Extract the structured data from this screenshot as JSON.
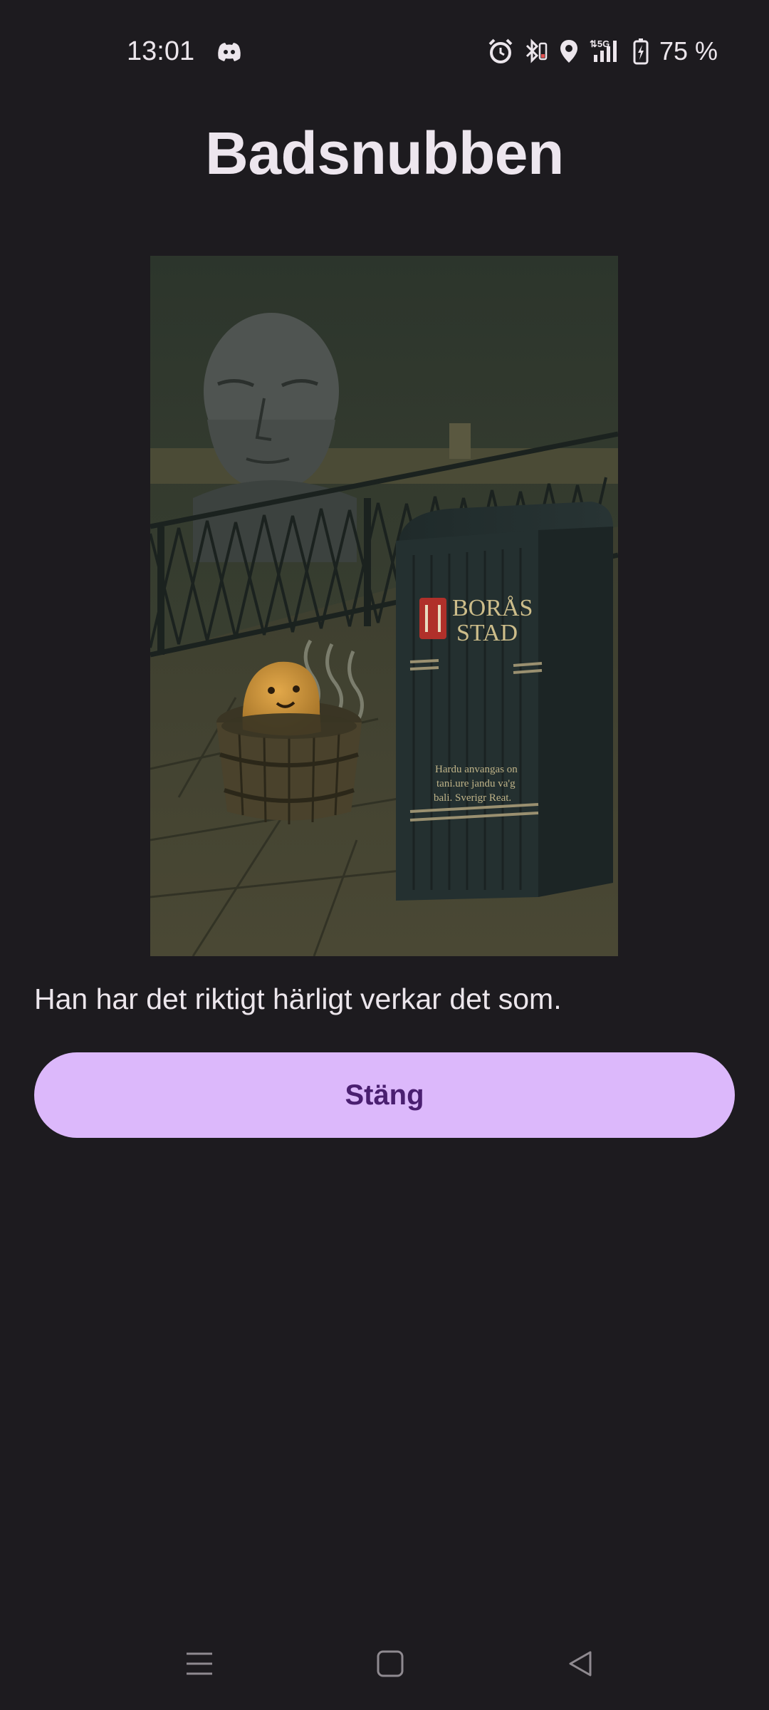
{
  "status_bar": {
    "time": "13:01",
    "battery_text": "75 %",
    "icons": [
      "discord-icon",
      "alarm-icon",
      "bluetooth-icon",
      "location-icon",
      "5g-signal-icon",
      "battery-charging-icon"
    ]
  },
  "dialog": {
    "title": "Badsnubben",
    "image": {
      "name": "bath-dude-illustration",
      "sign_text_line1": "BORÅS",
      "sign_text_line2": "STAD",
      "small_text": [
        "Hardu anvangas on",
        "tani.ure jandu va'g",
        "bali. Sverigr Reat."
      ]
    },
    "description": "Han har det riktigt härligt verkar det som.",
    "close_label": "Stäng"
  },
  "nav_bar": {
    "icons": [
      "recent-apps-icon",
      "home-icon",
      "back-icon"
    ]
  },
  "colors": {
    "background": "#1d1b1f",
    "button": "#dcb8fb",
    "button_text": "#4a1f70"
  }
}
